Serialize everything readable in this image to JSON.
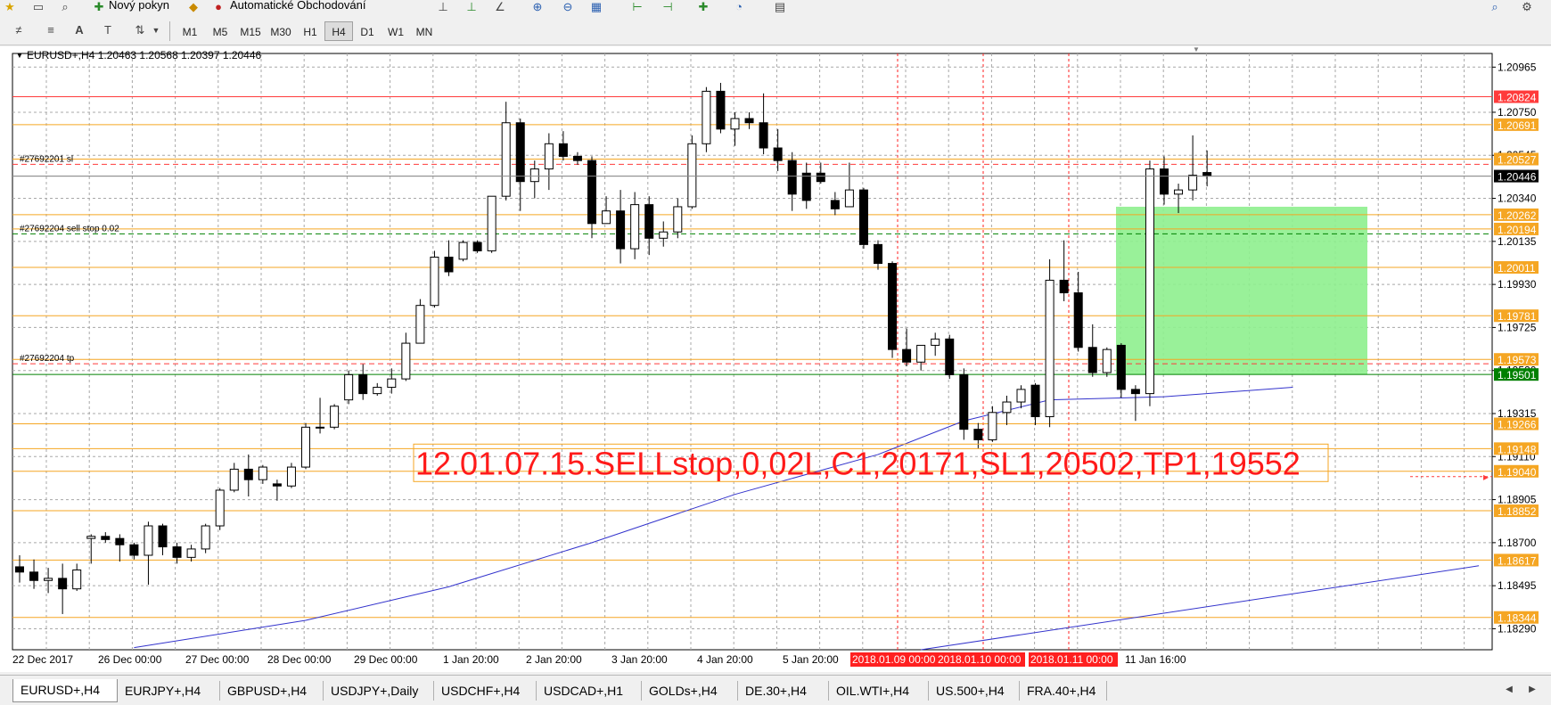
{
  "toolbar": {
    "new_order_label": "Nový pokyn",
    "auto_trading_label": "Automatické Obchodování",
    "timeframes": [
      "M1",
      "M5",
      "M15",
      "M30",
      "H1",
      "H4",
      "D1",
      "W1",
      "MN"
    ],
    "active_timeframe": "H4"
  },
  "chart_header": {
    "symbol_info": "EURUSD+,H4  1.20463 1.20568 1.20397 1.20446"
  },
  "chart_data": {
    "type": "candlestick",
    "ylim": [
      1.1819,
      1.2103
    ],
    "y_ticks": [
      "1.20965",
      "1.20750",
      "1.20545",
      "1.20340",
      "1.20135",
      "1.19930",
      "1.19725",
      "1.19520",
      "1.19315",
      "1.19110",
      "1.18905",
      "1.18700",
      "1.18495",
      "1.18290"
    ],
    "x_labels": [
      "22 Dec 2017",
      "26 Dec 00:00",
      "27 Dec 00:00",
      "28 Dec 00:00",
      "29 Dec 00:00",
      "1 Jan 20:00",
      "2 Jan 20:00",
      "3 Jan 20:00",
      "4 Jan 20:00",
      "5 Jan 20:00",
      "2018.01.09 00:00",
      "2018.01.10 00:00",
      "2018.01.11 00:00",
      "11 Jan 16:00"
    ],
    "highlighted_x_labels": [
      "2018.01.09 00:00",
      "2018.01.10 00:00",
      "2018.01.11 00:00"
    ],
    "candles": [
      [
        1.18585,
        1.1864,
        1.1851,
        1.1856
      ],
      [
        1.1856,
        1.1862,
        1.1848,
        1.1852
      ],
      [
        1.1852,
        1.1858,
        1.1846,
        1.1853
      ],
      [
        1.1853,
        1.186,
        1.1836,
        1.1848
      ],
      [
        1.1848,
        1.186,
        1.1847,
        1.1857
      ],
      [
        1.1872,
        1.1874,
        1.186,
        1.1873
      ],
      [
        1.1873,
        1.1875,
        1.187,
        1.18715
      ],
      [
        1.1872,
        1.1874,
        1.1861,
        1.1869
      ],
      [
        1.1869,
        1.187,
        1.1862,
        1.1864
      ],
      [
        1.1864,
        1.188,
        1.185,
        1.1878
      ],
      [
        1.1878,
        1.1879,
        1.1864,
        1.1868
      ],
      [
        1.1868,
        1.187,
        1.186,
        1.1863
      ],
      [
        1.1863,
        1.1869,
        1.1861,
        1.1867
      ],
      [
        1.1867,
        1.1879,
        1.1865,
        1.1878
      ],
      [
        1.1878,
        1.1896,
        1.1876,
        1.1895
      ],
      [
        1.1895,
        1.1908,
        1.1894,
        1.1905
      ],
      [
        1.1905,
        1.1912,
        1.1892,
        1.19
      ],
      [
        1.19,
        1.1907,
        1.1898,
        1.1906
      ],
      [
        1.1898,
        1.19,
        1.189,
        1.1897
      ],
      [
        1.1897,
        1.1908,
        1.1896,
        1.1906
      ],
      [
        1.1906,
        1.1927,
        1.1905,
        1.1925
      ],
      [
        1.1925,
        1.1939,
        1.1922,
        1.1925
      ],
      [
        1.1925,
        1.1936,
        1.1924,
        1.1935
      ],
      [
        1.1938,
        1.1952,
        1.1936,
        1.195
      ],
      [
        1.195,
        1.1955,
        1.1938,
        1.1941
      ],
      [
        1.1941,
        1.1946,
        1.194,
        1.1944
      ],
      [
        1.1944,
        1.1953,
        1.1941,
        1.1948
      ],
      [
        1.1948,
        1.197,
        1.1947,
        1.1965
      ],
      [
        1.1965,
        1.1986,
        1.1965,
        1.1983
      ],
      [
        1.1983,
        1.2009,
        1.1982,
        1.2006
      ],
      [
        1.2006,
        1.2014,
        1.1997,
        1.1999
      ],
      [
        1.2005,
        1.2014,
        1.2004,
        1.2013
      ],
      [
        1.2013,
        1.2014,
        1.2008,
        1.2009
      ],
      [
        1.2009,
        1.2035,
        1.2008,
        1.2035
      ],
      [
        1.2035,
        1.208,
        1.2033,
        1.207
      ],
      [
        1.207,
        1.2072,
        1.2028,
        1.2042
      ],
      [
        1.2042,
        1.2052,
        1.2034,
        1.2048
      ],
      [
        1.2048,
        1.2065,
        1.2038,
        1.206
      ],
      [
        1.206,
        1.2066,
        1.2052,
        1.2054
      ],
      [
        1.2054,
        1.2056,
        1.205,
        1.2052
      ],
      [
        1.2052,
        1.2054,
        1.2015,
        1.2022
      ],
      [
        1.2022,
        1.2035,
        1.2022,
        1.2028
      ],
      [
        1.2028,
        1.2038,
        1.2003,
        1.201
      ],
      [
        1.201,
        1.2037,
        1.2005,
        1.2031
      ],
      [
        1.2031,
        1.2035,
        1.2007,
        1.2015
      ],
      [
        1.2015,
        1.2023,
        1.2011,
        1.2018
      ],
      [
        1.2018,
        1.2034,
        1.2015,
        1.203
      ],
      [
        1.203,
        1.2064,
        1.2029,
        1.206
      ],
      [
        1.206,
        1.2087,
        1.2056,
        1.2085
      ],
      [
        1.2085,
        1.2089,
        1.2065,
        1.2067
      ],
      [
        1.2067,
        1.2075,
        1.2059,
        1.2072
      ],
      [
        1.2072,
        1.2075,
        1.2067,
        1.207
      ],
      [
        1.207,
        1.2084,
        1.2055,
        1.2058
      ],
      [
        1.2058,
        1.2067,
        1.2047,
        1.2052
      ],
      [
        1.2052,
        1.2056,
        1.2028,
        1.2036
      ],
      [
        1.2046,
        1.2051,
        1.2029,
        1.2033
      ],
      [
        1.2046,
        1.2051,
        1.2041,
        1.2042
      ],
      [
        1.2033,
        1.2037,
        1.2026,
        1.2029
      ],
      [
        1.203,
        1.2051,
        1.203,
        1.2038
      ],
      [
        1.2038,
        1.2039,
        1.201,
        1.2012
      ],
      [
        1.2012,
        1.2014,
        1.2,
        1.2003
      ],
      [
        1.2003,
        1.2004,
        1.1958,
        1.1962
      ],
      [
        1.1962,
        1.1972,
        1.1954,
        1.1956
      ],
      [
        1.1956,
        1.1964,
        1.1952,
        1.1964
      ],
      [
        1.1964,
        1.197,
        1.1959,
        1.1967
      ],
      [
        1.1967,
        1.1969,
        1.1948,
        1.195
      ],
      [
        1.195,
        1.1953,
        1.1919,
        1.1924
      ],
      [
        1.1924,
        1.1927,
        1.1915,
        1.1919
      ],
      [
        1.1919,
        1.1935,
        1.1918,
        1.1932
      ],
      [
        1.1932,
        1.194,
        1.1926,
        1.1937
      ],
      [
        1.1937,
        1.1945,
        1.1934,
        1.1943
      ],
      [
        1.1945,
        1.1946,
        1.1926,
        1.193
      ],
      [
        1.193,
        1.2005,
        1.1925,
        1.1995
      ],
      [
        1.1995,
        1.2014,
        1.1985,
        1.1989
      ],
      [
        1.1989,
        1.1999,
        1.1961,
        1.1963
      ],
      [
        1.1963,
        1.1974,
        1.1949,
        1.1951
      ],
      [
        1.1951,
        1.1963,
        1.1949,
        1.1962
      ],
      [
        1.1964,
        1.1965,
        1.1939,
        1.1943
      ],
      [
        1.1943,
        1.1945,
        1.1928,
        1.1941
      ],
      [
        1.1941,
        1.2052,
        1.1935,
        1.2048
      ],
      [
        1.2048,
        1.2054,
        1.2031,
        1.2036
      ],
      [
        1.2036,
        1.2041,
        1.2027,
        1.2038
      ],
      [
        1.2038,
        1.2064,
        1.2033,
        1.2045
      ],
      [
        1.20463,
        1.20568,
        1.20397,
        1.20446
      ]
    ],
    "moving_averages": [
      {
        "color": "#3333cc",
        "points": [
          [
            8,
            1.182
          ],
          [
            20,
            1.1833
          ],
          [
            30,
            1.1849
          ],
          [
            40,
            1.187
          ],
          [
            50,
            1.1893
          ],
          [
            60,
            1.1912
          ],
          [
            66,
            1.1928
          ],
          [
            72,
            1.1938
          ],
          [
            80,
            1.19395
          ],
          [
            89,
            1.1944
          ]
        ]
      },
      {
        "color": "#3333cc",
        "points": [
          [
            63,
            1.1819
          ],
          [
            102,
            1.1859
          ]
        ]
      }
    ],
    "horizontal_levels": [
      {
        "price": "1.20824",
        "color": "#ff3b3b",
        "label_bg": "#ff3b3b"
      },
      {
        "price": "1.20691",
        "color": "#f5a623",
        "label_bg": "#f5a623"
      },
      {
        "price": "1.20527",
        "color": "#f5a623",
        "label_bg": "#f5a623"
      },
      {
        "price": "1.20446",
        "color": "#b0b0b0",
        "label_bg": "#000000"
      },
      {
        "price": "1.20262",
        "color": "#f5a623",
        "label_bg": "#f5a623"
      },
      {
        "price": "1.20194",
        "color": "#f5a623",
        "label_bg": "#f5a623"
      },
      {
        "price": "1.20011",
        "color": "#f5a623",
        "label_bg": "#f5a623"
      },
      {
        "price": "1.19781",
        "color": "#f5a623",
        "label_bg": "#f5a623"
      },
      {
        "price": "1.19573",
        "color": "#f5a623",
        "label_bg": "#f5a623"
      },
      {
        "price": "1.19501",
        "color": "#008000",
        "label_bg": "#008000"
      },
      {
        "price": "1.19266",
        "color": "#f5a623",
        "label_bg": "#f5a623"
      },
      {
        "price": "1.19148",
        "color": "#f5a623",
        "label_bg": "#f5a623"
      },
      {
        "price": "1.19040",
        "color": "#f5a623",
        "label_bg": "#f5a623"
      },
      {
        "price": "1.18852",
        "color": "#f5a623",
        "label_bg": "#f5a623"
      },
      {
        "price": "1.18617",
        "color": "#f5a623",
        "label_bg": "#f5a623"
      },
      {
        "price": "1.18344",
        "color": "#f5a623",
        "label_bg": "#f5a623"
      }
    ],
    "order_lines": [
      {
        "label": "#27692201 sl",
        "price": 1.20502,
        "color": "#ff3b3b"
      },
      {
        "label": "#27692204 sell stop 0.02",
        "price": 1.20171,
        "color": "#008000"
      },
      {
        "label": "#27692204 tp",
        "price": 1.19552,
        "color": "#ff3b3b"
      }
    ],
    "annotation": "12.01.07.15.SELLstop,0,02L,C1,20171,SL1,20502,TP1,19552"
  },
  "tabs": [
    "EURUSD+,H4",
    "EURJPY+,H4",
    "GBPUSD+,H4",
    "USDJPY+,Daily",
    "USDCHF+,H4",
    "USDCAD+,H1",
    "GOLDs+,H4",
    "DE.30+,H4",
    "OIL.WTI+,H4",
    "US.500+,H4",
    "FRA.40+,H4"
  ],
  "active_tab": "EURUSD+,H4"
}
